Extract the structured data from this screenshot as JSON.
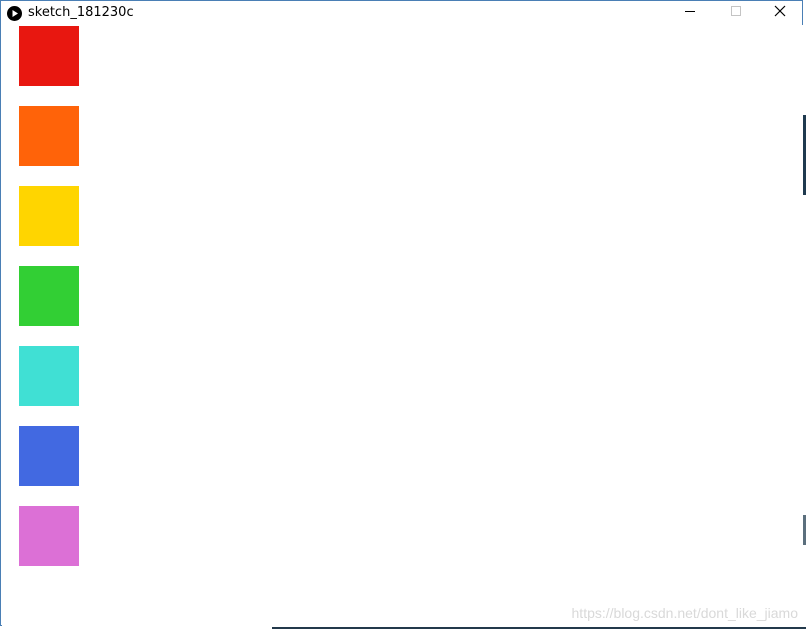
{
  "window": {
    "title": "sketch_181230c",
    "app_icon": "play-icon",
    "controls": {
      "minimize_icon": "minimize-icon",
      "maximize_icon": "maximize-icon",
      "close_icon": "close-icon"
    }
  },
  "canvas": {
    "background": "#ffffff",
    "swatches": [
      {
        "color": "#e81710"
      },
      {
        "color": "#ff6309"
      },
      {
        "color": "#ffd500"
      },
      {
        "color": "#32cf34"
      },
      {
        "color": "#40e0d4"
      },
      {
        "color": "#4269e1"
      },
      {
        "color": "#dc70d6"
      }
    ]
  },
  "watermark": "https://blog.csdn.net/dont_like_jiamo"
}
